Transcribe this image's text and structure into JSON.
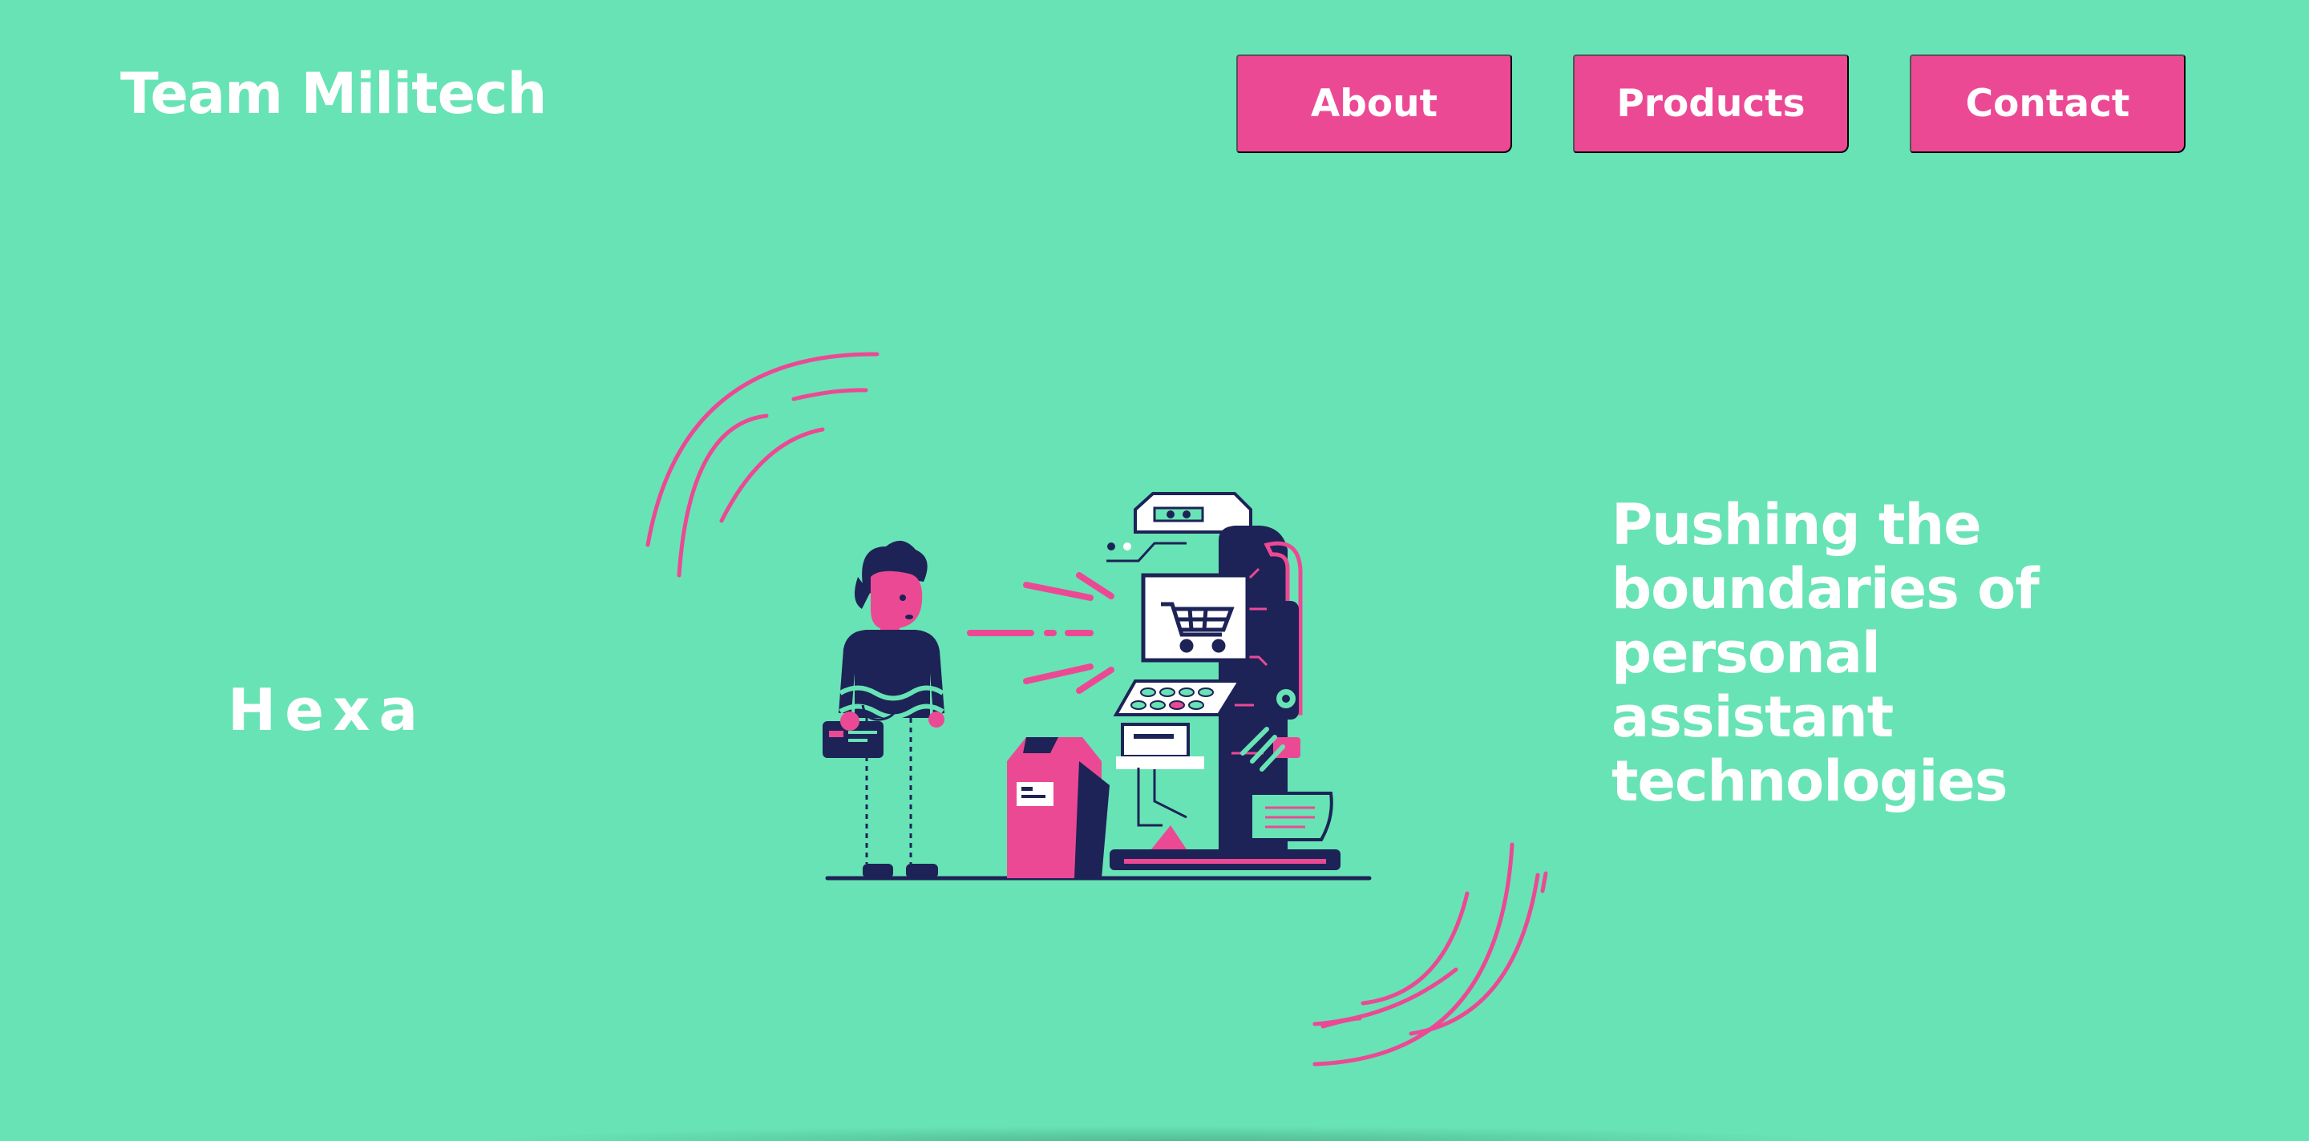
{
  "header": {
    "brand": "Team Militech",
    "nav": [
      {
        "label": "About"
      },
      {
        "label": "Products"
      },
      {
        "label": "Contact"
      }
    ]
  },
  "hero": {
    "product_name": "Hexa",
    "tagline": "Pushing the boundaries of personal assistant technologies",
    "illustration_icons": [
      "person-icon",
      "shopping-cart-icon",
      "terminal-icon",
      "credit-card-icon"
    ]
  },
  "colors": {
    "background": "#68e3b5",
    "accent": "#ec4995",
    "navy": "#1d2356",
    "text": "#ffffff"
  }
}
